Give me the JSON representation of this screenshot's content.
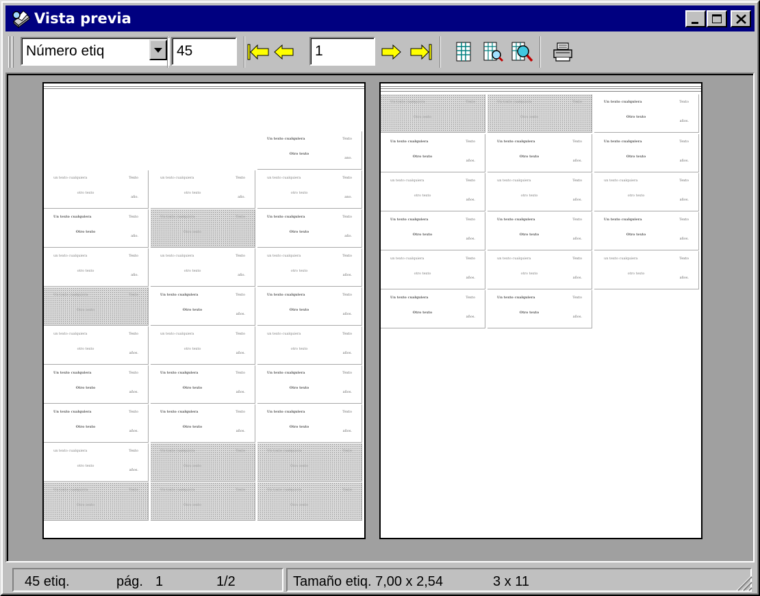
{
  "window": {
    "title": "Vista previa",
    "title_icon": "printer-magnifier-icon",
    "controls": [
      "minimize-icon",
      "maximize-icon",
      "close-icon"
    ]
  },
  "toolbar": {
    "field_select": {
      "selected": "Número etiq"
    },
    "label_number": "45",
    "page_input": "1",
    "icons": {
      "first": "first-page-arrow-icon",
      "prev": "previous-page-arrow-icon",
      "next": "next-page-arrow-icon",
      "last": "last-page-arrow-icon",
      "grid": "grid-icon",
      "zoom": "zoom-page-icon",
      "zoom_detail": "zoom-magnifier-icon",
      "print": "printer-icon"
    },
    "colors": {
      "arrow": "#ffff00"
    }
  },
  "labels": {
    "styleA": {
      "l1": "Un texto cualquiera",
      "l2": "Otro texto",
      "r1": "Texto"
    },
    "styleB": {
      "l1": "un texto cualquiera",
      "l2": "otro texto",
      "r1": "Texto"
    }
  },
  "page1": {
    "cells": [
      {
        "s": "A",
        "end": "ano."
      },
      {
        "s": "B",
        "end": "año."
      },
      {
        "s": "B",
        "end": "año."
      },
      {
        "s": "B",
        "end": "ano."
      },
      {
        "s": "A",
        "end": "año."
      },
      {
        "s": "S",
        "end": ""
      },
      {
        "s": "A",
        "end": "año."
      },
      {
        "s": "B",
        "end": "año."
      },
      {
        "s": "B",
        "end": "año."
      },
      {
        "s": "B",
        "end": "años."
      },
      {
        "s": "S",
        "end": ""
      },
      {
        "s": "A",
        "end": "años."
      },
      {
        "s": "A",
        "end": "años."
      },
      {
        "s": "B",
        "end": "años."
      },
      {
        "s": "B",
        "end": "años."
      },
      {
        "s": "B",
        "end": "años."
      },
      {
        "s": "A",
        "end": "años."
      },
      {
        "s": "A",
        "end": "años."
      },
      {
        "s": "A",
        "end": "años."
      },
      {
        "s": "A",
        "end": "años."
      },
      {
        "s": "A",
        "end": "años."
      },
      {
        "s": "A",
        "end": "años."
      },
      {
        "s": "B",
        "end": "años."
      },
      {
        "s": "S",
        "end": ""
      },
      {
        "s": "S",
        "end": ""
      },
      {
        "s": "S",
        "end": ""
      },
      {
        "s": "S",
        "end": ""
      },
      {
        "s": "S",
        "end": ""
      }
    ]
  },
  "page2": {
    "cells": [
      {
        "s": "S",
        "end": ""
      },
      {
        "s": "S",
        "end": ""
      },
      {
        "s": "A",
        "end": "años."
      },
      {
        "s": "A",
        "end": "años."
      },
      {
        "s": "A",
        "end": "años."
      },
      {
        "s": "A",
        "end": "años."
      },
      {
        "s": "B",
        "end": "años."
      },
      {
        "s": "B",
        "end": "años."
      },
      {
        "s": "B",
        "end": "años."
      },
      {
        "s": "A",
        "end": "años."
      },
      {
        "s": "A",
        "end": "años."
      },
      {
        "s": "A",
        "end": "años."
      },
      {
        "s": "B",
        "end": "años."
      },
      {
        "s": "B",
        "end": "años."
      },
      {
        "s": "B",
        "end": "años."
      },
      {
        "s": "A",
        "end": "años."
      },
      {
        "s": "A",
        "end": "años."
      }
    ]
  },
  "status": {
    "count": "45 etiq.",
    "page_label": "pág.",
    "page_num": "1",
    "page_of": "1/2",
    "size": "Tamaño etiq. 7,00 x 2,54",
    "layout": "3 x 11"
  }
}
